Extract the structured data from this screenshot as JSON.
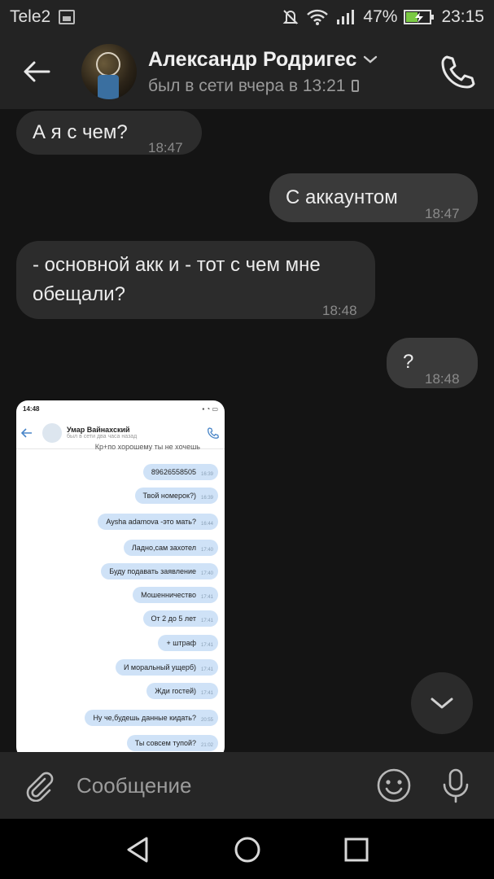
{
  "status_bar": {
    "carrier": "Tele2",
    "battery": "47%",
    "time": "23:15"
  },
  "header": {
    "contact_name": "Александр Родригес",
    "last_seen": "был в сети вчера в 13:21"
  },
  "messages": [
    {
      "text": "А я с чем?",
      "time": "18:47",
      "direction": "in"
    },
    {
      "text": "С аккаунтом",
      "time": "18:47",
      "direction": "out"
    },
    {
      "text": "- основной акк и - тот с чем мне обещали?",
      "time": "18:48",
      "direction": "in"
    },
    {
      "text": "?",
      "time": "18:48",
      "direction": "out"
    }
  ],
  "photo": {
    "status_time": "14:48",
    "contact_name": "Умар Вайнахский",
    "last_seen": "был в сети два часа назад",
    "cut_message": "Кр+по хорошему ты не хочешь",
    "bubbles": [
      {
        "text": "89626558505",
        "time": "16:39"
      },
      {
        "text": "Твой номерок?)",
        "time": "16:39"
      },
      {
        "text": "Aysha adamova -это мать?",
        "time": "16:44"
      },
      {
        "text": "Ладно,сам захотел",
        "time": "17:40"
      },
      {
        "text": "Буду подавать заявление",
        "time": "17:40"
      },
      {
        "text": "Мошенничество",
        "time": "17:41"
      },
      {
        "text": "От 2 до 5 лет",
        "time": "17:41"
      },
      {
        "text": "+ штраф",
        "time": "17:41"
      },
      {
        "text": "И моральный ущерб)",
        "time": "17:41"
      },
      {
        "text": "Жди гостей)",
        "time": "17:41"
      },
      {
        "text": "Ну че,будешь данные кидать?",
        "time": "20:55"
      },
      {
        "text": "Ты совсем тупой?",
        "time": "21:02"
      }
    ]
  },
  "composer": {
    "placeholder": "Сообщение"
  },
  "icons": {
    "back": "arrow-left-icon",
    "call": "phone-icon",
    "attach": "paperclip-icon",
    "emoji": "smiley-icon",
    "mic": "microphone-icon",
    "scroll": "chevron-down-icon"
  }
}
